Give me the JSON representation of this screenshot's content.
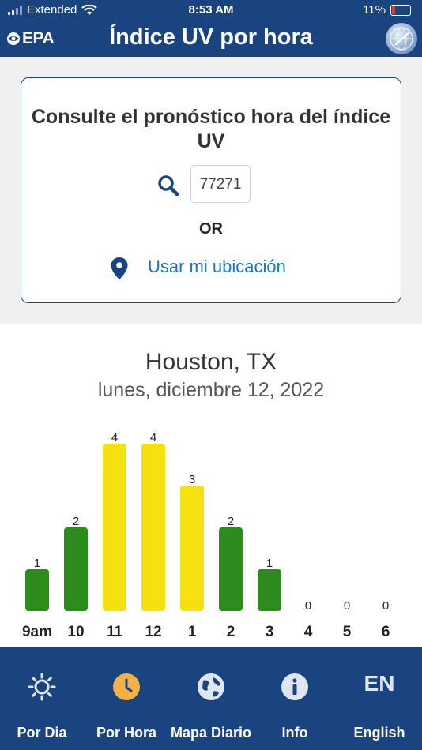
{
  "status_bar": {
    "carrier": "Extended",
    "time": "8:53 AM",
    "battery": "11%"
  },
  "header": {
    "logo": "EPA",
    "title": "Índice UV por hora"
  },
  "search": {
    "prompt": "Consulte el pronóstico hora del índice UV",
    "zip_value": "77271",
    "or_label": "OR",
    "location_link": "Usar mi ubicación"
  },
  "result": {
    "city": "Houston, TX",
    "date": "lunes, diciembre 12, 2022"
  },
  "colors": {
    "primary": "#1a4480",
    "green": "#2e8b1e",
    "yellow": "#f5e010",
    "link": "#1b74c8",
    "active_tab": "#f2b142"
  },
  "chart_data": {
    "type": "bar",
    "categories": [
      "9am",
      "10",
      "11",
      "12",
      "1",
      "2",
      "3",
      "4",
      "5",
      "6"
    ],
    "values": [
      1,
      2,
      4,
      4,
      3,
      2,
      1,
      0,
      0,
      0
    ],
    "colors": [
      "#2e8b1e",
      "#2e8b1e",
      "#f5e010",
      "#f5e010",
      "#f5e010",
      "#2e8b1e",
      "#2e8b1e",
      "#2e8b1e",
      "#2e8b1e",
      "#2e8b1e"
    ],
    "ylim": [
      0,
      4
    ]
  },
  "bottom_nav": {
    "items": [
      {
        "label": "Por Dia",
        "icon": "sun-icon"
      },
      {
        "label": "Por Hora",
        "icon": "clock-icon",
        "active": true
      },
      {
        "label": "Mapa Diario",
        "icon": "globe-icon"
      },
      {
        "label": "Info",
        "icon": "info-icon"
      },
      {
        "label": "English",
        "icon": "language-icon",
        "icon_text": "EN"
      }
    ]
  }
}
